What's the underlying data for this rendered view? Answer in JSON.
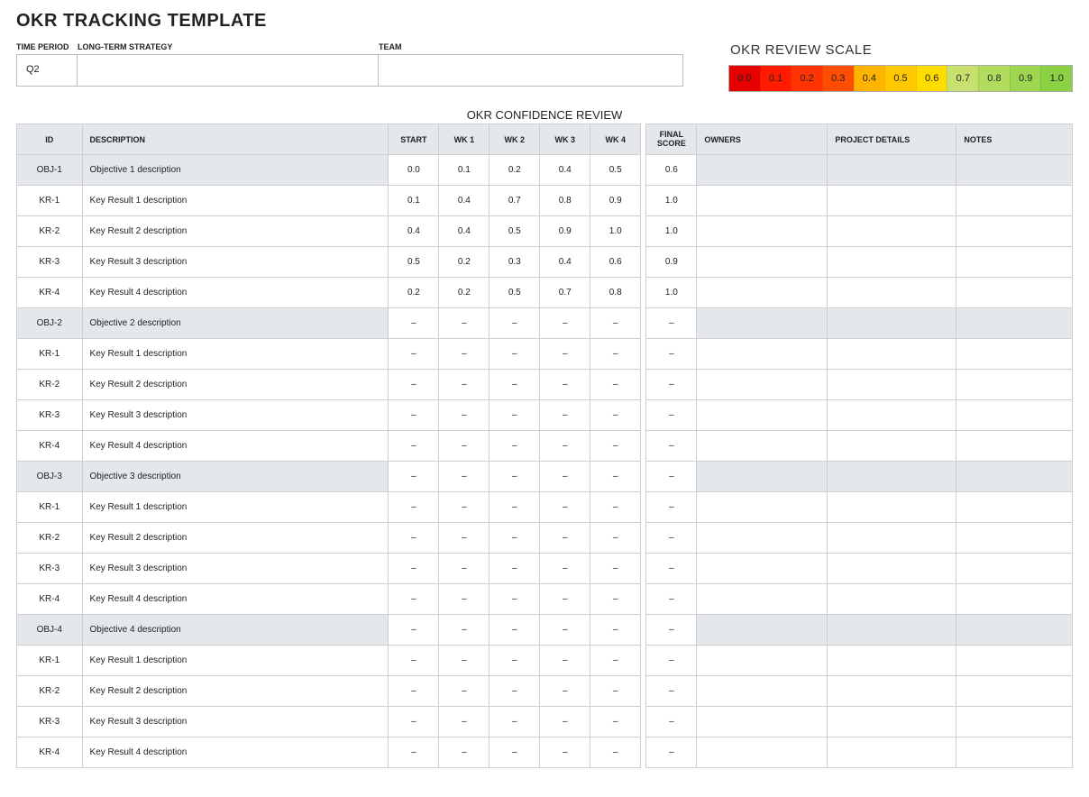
{
  "title": "OKR TRACKING TEMPLATE",
  "fields": {
    "time_period": {
      "label": "TIME PERIOD",
      "value": "Q2"
    },
    "strategy": {
      "label": "LONG-TERM STRATEGY",
      "value": ""
    },
    "team": {
      "label": "TEAM",
      "value": ""
    }
  },
  "scale": {
    "title": "OKR REVIEW SCALE",
    "values": [
      "0.0",
      "0.1",
      "0.2",
      "0.3",
      "0.4",
      "0.5",
      "0.6",
      "0.7",
      "0.8",
      "0.9",
      "1.0"
    ]
  },
  "confidence_title": "OKR CONFIDENCE REVIEW",
  "columns": {
    "id": "ID",
    "desc": "DESCRIPTION",
    "start": "START",
    "wk1": "WK 1",
    "wk2": "WK 2",
    "wk3": "WK 3",
    "wk4": "WK 4",
    "final": "FINAL SCORE",
    "owners": "OWNERS",
    "project": "PROJECT DETAILS",
    "notes": "NOTES"
  },
  "rows": [
    {
      "type": "obj",
      "id": "OBJ-1",
      "desc": "Objective 1 description",
      "scores": [
        "0.0",
        "0.1",
        "0.2",
        "0.4",
        "0.5"
      ],
      "final": "0.6",
      "owners": "",
      "project": "",
      "notes": ""
    },
    {
      "type": "kr",
      "id": "KR-1",
      "desc": "Key Result 1 description",
      "scores": [
        "0.1",
        "0.4",
        "0.7",
        "0.8",
        "0.9"
      ],
      "final": "1.0",
      "owners": "",
      "project": "",
      "notes": ""
    },
    {
      "type": "kr",
      "id": "KR-2",
      "desc": "Key Result 2 description",
      "scores": [
        "0.4",
        "0.4",
        "0.5",
        "0.9",
        "1.0"
      ],
      "final": "1.0",
      "owners": "",
      "project": "",
      "notes": ""
    },
    {
      "type": "kr",
      "id": "KR-3",
      "desc": "Key Result 3 description",
      "scores": [
        "0.5",
        "0.2",
        "0.3",
        "0.4",
        "0.6"
      ],
      "final": "0.9",
      "owners": "",
      "project": "",
      "notes": ""
    },
    {
      "type": "kr",
      "id": "KR-4",
      "desc": "Key Result 4 description",
      "scores": [
        "0.2",
        "0.2",
        "0.5",
        "0.7",
        "0.8"
      ],
      "final": "1.0",
      "owners": "",
      "project": "",
      "notes": ""
    },
    {
      "type": "obj",
      "id": "OBJ-2",
      "desc": "Objective 2 description",
      "scores": [
        "–",
        "–",
        "–",
        "–",
        "–"
      ],
      "final": "–",
      "owners": "",
      "project": "",
      "notes": ""
    },
    {
      "type": "kr",
      "id": "KR-1",
      "desc": "Key Result 1 description",
      "scores": [
        "–",
        "–",
        "–",
        "–",
        "–"
      ],
      "final": "–",
      "owners": "",
      "project": "",
      "notes": ""
    },
    {
      "type": "kr",
      "id": "KR-2",
      "desc": "Key Result 2 description",
      "scores": [
        "–",
        "–",
        "–",
        "–",
        "–"
      ],
      "final": "–",
      "owners": "",
      "project": "",
      "notes": ""
    },
    {
      "type": "kr",
      "id": "KR-3",
      "desc": "Key Result 3 description",
      "scores": [
        "–",
        "–",
        "–",
        "–",
        "–"
      ],
      "final": "–",
      "owners": "",
      "project": "",
      "notes": ""
    },
    {
      "type": "kr",
      "id": "KR-4",
      "desc": "Key Result 4 description",
      "scores": [
        "–",
        "–",
        "–",
        "–",
        "–"
      ],
      "final": "–",
      "owners": "",
      "project": "",
      "notes": ""
    },
    {
      "type": "obj",
      "id": "OBJ-3",
      "desc": "Objective 3 description",
      "scores": [
        "–",
        "–",
        "–",
        "–",
        "–"
      ],
      "final": "–",
      "owners": "",
      "project": "",
      "notes": ""
    },
    {
      "type": "kr",
      "id": "KR-1",
      "desc": "Key Result 1 description",
      "scores": [
        "–",
        "–",
        "–",
        "–",
        "–"
      ],
      "final": "–",
      "owners": "",
      "project": "",
      "notes": ""
    },
    {
      "type": "kr",
      "id": "KR-2",
      "desc": "Key Result 2 description",
      "scores": [
        "–",
        "–",
        "–",
        "–",
        "–"
      ],
      "final": "–",
      "owners": "",
      "project": "",
      "notes": ""
    },
    {
      "type": "kr",
      "id": "KR-3",
      "desc": "Key Result 3 description",
      "scores": [
        "–",
        "–",
        "–",
        "–",
        "–"
      ],
      "final": "–",
      "owners": "",
      "project": "",
      "notes": ""
    },
    {
      "type": "kr",
      "id": "KR-4",
      "desc": "Key Result 4 description",
      "scores": [
        "–",
        "–",
        "–",
        "–",
        "–"
      ],
      "final": "–",
      "owners": "",
      "project": "",
      "notes": ""
    },
    {
      "type": "obj",
      "id": "OBJ-4",
      "desc": "Objective 4 description",
      "scores": [
        "–",
        "–",
        "–",
        "–",
        "–"
      ],
      "final": "–",
      "owners": "",
      "project": "",
      "notes": ""
    },
    {
      "type": "kr",
      "id": "KR-1",
      "desc": "Key Result 1 description",
      "scores": [
        "–",
        "–",
        "–",
        "–",
        "–"
      ],
      "final": "–",
      "owners": "",
      "project": "",
      "notes": ""
    },
    {
      "type": "kr",
      "id": "KR-2",
      "desc": "Key Result 2 description",
      "scores": [
        "–",
        "–",
        "–",
        "–",
        "–"
      ],
      "final": "–",
      "owners": "",
      "project": "",
      "notes": ""
    },
    {
      "type": "kr",
      "id": "KR-3",
      "desc": "Key Result 3 description",
      "scores": [
        "–",
        "–",
        "–",
        "–",
        "–"
      ],
      "final": "–",
      "owners": "",
      "project": "",
      "notes": ""
    },
    {
      "type": "kr",
      "id": "KR-4",
      "desc": "Key Result 4 description",
      "scores": [
        "–",
        "–",
        "–",
        "–",
        "–"
      ],
      "final": "–",
      "owners": "",
      "project": "",
      "notes": ""
    }
  ]
}
